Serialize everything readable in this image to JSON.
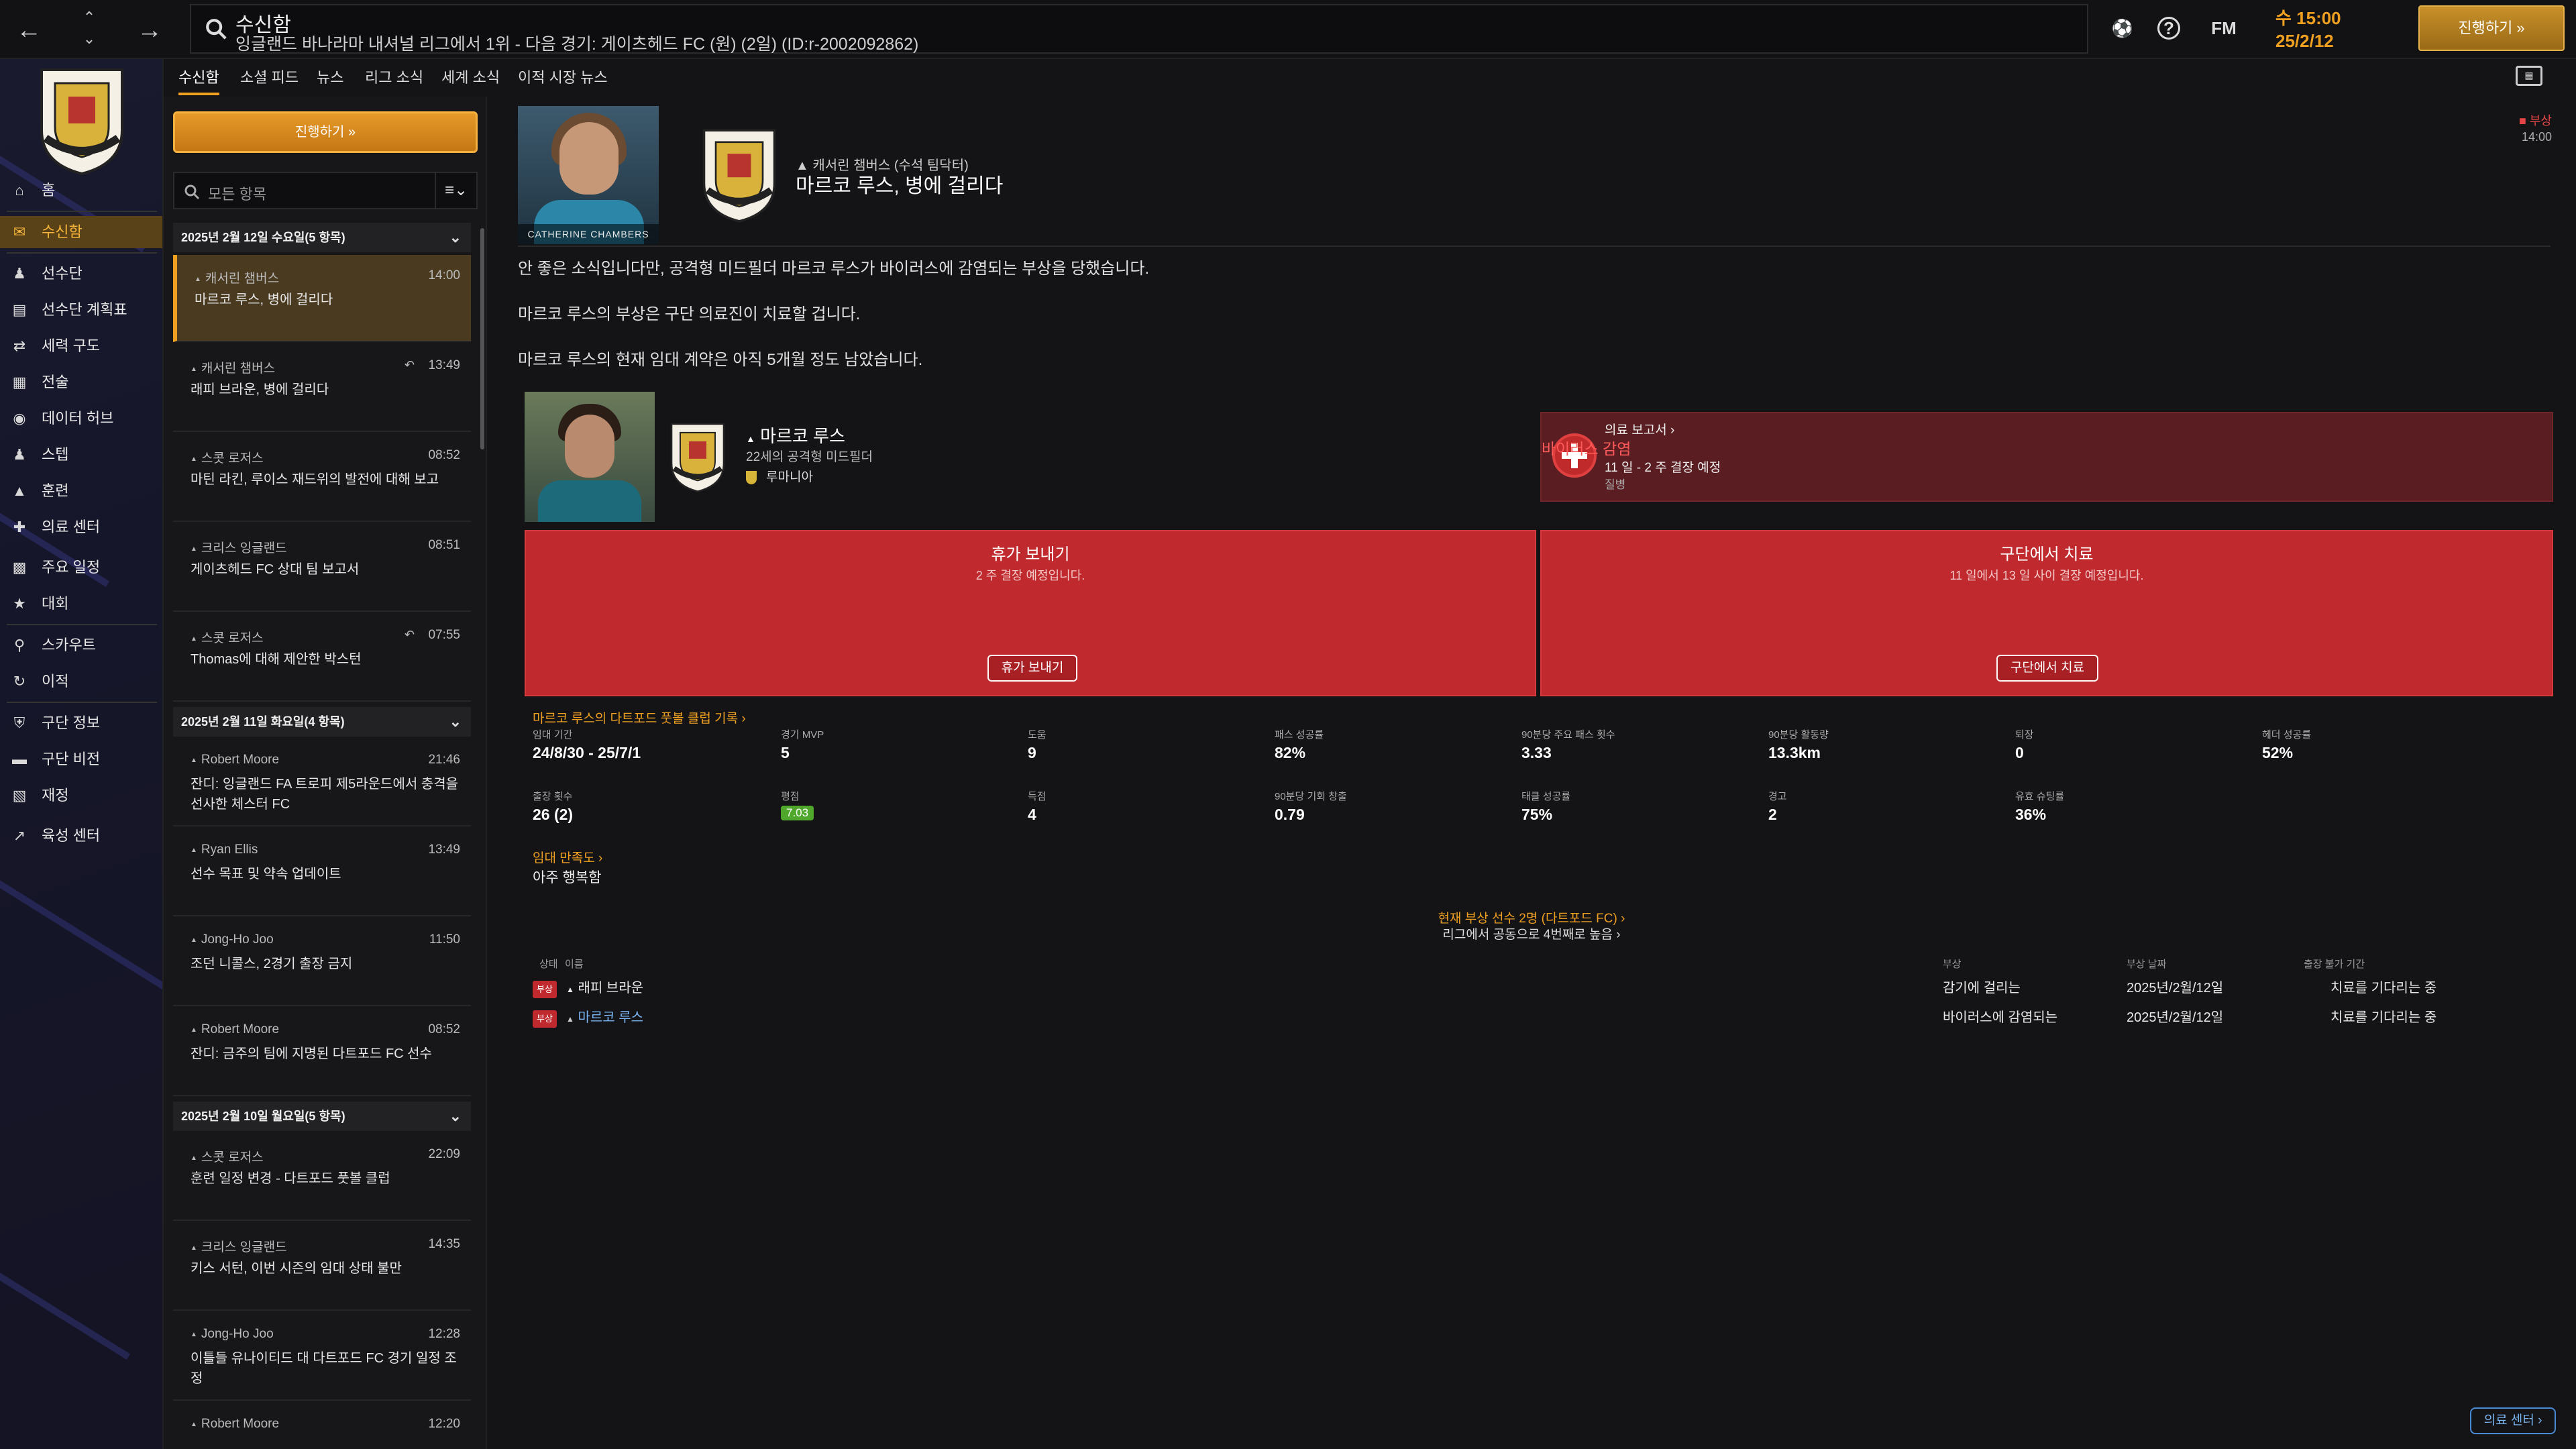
{
  "topbar": {
    "title": "수신함",
    "subtitle": "잉글랜드 바나라마 내셔널 리그에서 1위 - 다음 경기: 게이츠헤드 FC (원) (2일) (ID:r-2002092862)",
    "fm_label": "FM",
    "time": "수 15:00",
    "date": "25/2/12",
    "continue_label": "진행하기 »"
  },
  "sidebar": {
    "items": [
      {
        "label": "홈",
        "icon": "home-icon"
      },
      {
        "label": "수신함",
        "icon": "inbox-icon"
      },
      {
        "label": "선수단",
        "icon": "squad-icon"
      },
      {
        "label": "선수단 계획표",
        "icon": "planner-icon"
      },
      {
        "label": "세력 구도",
        "icon": "dynamics-icon"
      },
      {
        "label": "전술",
        "icon": "tactics-icon"
      },
      {
        "label": "데이터 허브",
        "icon": "data-hub-icon"
      },
      {
        "label": "스텝",
        "icon": "staff-icon"
      },
      {
        "label": "훈련",
        "icon": "training-icon"
      },
      {
        "label": "의료 센터",
        "icon": "medical-icon"
      },
      {
        "label": "주요 일정",
        "icon": "calendar-icon"
      },
      {
        "label": "대회",
        "icon": "trophy-icon"
      },
      {
        "label": "스카우트",
        "icon": "scout-icon"
      },
      {
        "label": "이적",
        "icon": "transfer-icon"
      },
      {
        "label": "구단 정보",
        "icon": "club-info-icon"
      },
      {
        "label": "구단 비전",
        "icon": "vision-icon"
      },
      {
        "label": "재정",
        "icon": "finance-icon"
      },
      {
        "label": "육성 센터",
        "icon": "development-icon"
      }
    ]
  },
  "tabs": [
    "수신함",
    "소셜 피드",
    "뉴스",
    "리그 소식",
    "세계 소식",
    "이적 시장 뉴스"
  ],
  "inbox": {
    "continue_label": "진행하기 »",
    "filter_placeholder": "모든 항목",
    "groups": [
      {
        "title": "2025년 2월 12일 수요일(5 항목)"
      },
      {
        "title": "2025년 2월 11일 화요일(4 항목)"
      },
      {
        "title": "2025년 2월 10일 월요일(5 항목)"
      }
    ],
    "messages": [
      {
        "sender": "캐서린 챔버스",
        "time": "14:00",
        "subject": "마르코 루스, 병에 걸리다"
      },
      {
        "sender": "캐서린 챔버스",
        "time": "13:49",
        "subject": "래피 브라운, 병에 걸리다"
      },
      {
        "sender": "스콧 로저스",
        "time": "08:52",
        "subject": "마틴 라킨, 루이스 재드위의 발전에 대해 보고"
      },
      {
        "sender": "크리스 잉글랜드",
        "time": "08:51",
        "subject": "게이츠헤드 FC 상대 팀 보고서"
      },
      {
        "sender": "스콧 로저스",
        "time": "07:55",
        "subject": "Thomas에 대해 제안한 박스턴"
      },
      {
        "sender": "Robert Moore",
        "time": "21:46",
        "subject": "잔디: 잉글랜드 FA 트로피 제5라운드에서 충격을 선사한 체스터 FC"
      },
      {
        "sender": "Ryan Ellis",
        "time": "13:49",
        "subject": "선수 목표 및 약속 업데이트"
      },
      {
        "sender": "Jong-Ho Joo",
        "time": "11:50",
        "subject": "조던 니콜스, 2경기 출장 금지"
      },
      {
        "sender": "Robert Moore",
        "time": "08:52",
        "subject": "잔디: 금주의 팀에 지명된 다트포드 FC 선수"
      },
      {
        "sender": "스콧 로저스",
        "time": "22:09",
        "subject": "훈련 일정 변경 - 다트포드 풋볼 클럽"
      },
      {
        "sender": "크리스 잉글랜드",
        "time": "14:35",
        "subject": "키스 서턴, 이번 시즌의 임대 상태 불만"
      },
      {
        "sender": "Jong-Ho Joo",
        "time": "12:28",
        "subject": "이틀들 유나이티드 대 다트포드 FC 경기 일정 조정"
      },
      {
        "sender": "Robert Moore",
        "time": "12:20",
        "subject": ""
      }
    ]
  },
  "message": {
    "staff_name_plate": "CATHERINE CHAMBERS",
    "from": "캐서린 챔버스 (수석 팀닥터)",
    "title": "마르코 루스, 병에 걸리다",
    "badge_label": "부상",
    "badge_time": "14:00",
    "paragraphs": [
      "안 좋은 소식입니다만, 공격형 미드필더 마르코 루스가 바이러스에 감염되는 부상을 당했습니다.",
      "마르코 루스의 부상은 구단 의료진이 치료할 겁니다.",
      "마르코 루스의 현재 임대 계약은 아직 5개월 정도 남았습니다."
    ]
  },
  "player": {
    "name": "마르코 루스",
    "age_position": "22세의 공격형 미드필더",
    "nation": "루마니아"
  },
  "medical": {
    "report_link": "의료 보고서 ›",
    "condition": "바이러스 감염",
    "duration": "11 일 - 2 주 결장 예정",
    "type": "질병"
  },
  "actions": [
    {
      "title": "휴가 보내기",
      "sub": "2 주 결장 예정입니다.",
      "button": "휴가 보내기"
    },
    {
      "title": "구단에서 치료",
      "sub": "11 일에서 13 일 사이 결장 예정입니다.",
      "button": "구단에서 치료"
    }
  ],
  "stats": {
    "link": "마르코 루스의 다트포드 풋볼 클럽 기록 ›",
    "row1": [
      {
        "label": "임대 기간",
        "value": "24/8/30 - 25/7/1"
      },
      {
        "label": "경기 MVP",
        "value": "5"
      },
      {
        "label": "도움",
        "value": "9"
      },
      {
        "label": "패스 성공률",
        "value": "82%"
      },
      {
        "label": "90분당 주요 패스 횟수",
        "value": "3.33"
      },
      {
        "label": "90분당 활동량",
        "value": "13.3km"
      },
      {
        "label": "퇴장",
        "value": "0"
      },
      {
        "label": "헤더 성공률",
        "value": "52%"
      }
    ],
    "row2": [
      {
        "label": "출장 횟수",
        "value": "26 (2)"
      },
      {
        "label": "평점",
        "value": "7.03"
      },
      {
        "label": "득점",
        "value": "4"
      },
      {
        "label": "90분당 기회 창출",
        "value": "0.79"
      },
      {
        "label": "태클 성공률",
        "value": "75%"
      },
      {
        "label": "경고",
        "value": "2"
      },
      {
        "label": "유효 슈팅률",
        "value": "36%"
      }
    ]
  },
  "loan": {
    "link": "임대 만족도 ›",
    "value": "아주 행복함"
  },
  "injury_summary": {
    "line1": "현재 부상 선수 2명 (다트포드 FC) ›",
    "line2": "리그에서 공동으로 4번째로 높음 ›"
  },
  "injury_table": {
    "headers": {
      "status": "상태",
      "name": "이름",
      "injury": "부상",
      "date": "부상 날짜",
      "return": "출장 불가 기간"
    },
    "rows": [
      {
        "tag": "부상",
        "name": "래피 브라운",
        "injury": "감기에 걸리는",
        "date": "2025년/2월/12일",
        "return": "치료를 기다리는 중",
        "link": false
      },
      {
        "tag": "부상",
        "name": "마르코 루스",
        "injury": "바이러스에 감염되는",
        "date": "2025년/2월/12일",
        "return": "치료를 기다리는 중",
        "link": true
      }
    ]
  },
  "footer": {
    "medical_center_button": "의료 센터 ›"
  },
  "colors": {
    "accent": "#f0a020",
    "injury_red": "#c0292d",
    "link_blue": "#7ab4f0"
  }
}
